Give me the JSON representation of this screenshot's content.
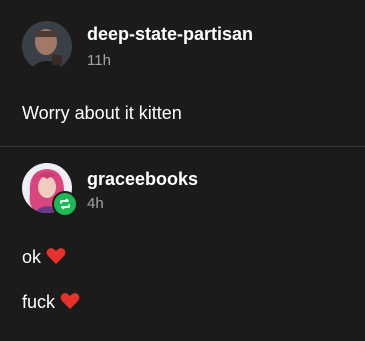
{
  "posts": [
    {
      "author": "deep-state-partisan",
      "time": "11h",
      "body": "Worry about it kitten"
    },
    {
      "author": "graceebooks",
      "time": "4h",
      "lines": [
        "ok",
        "fuck"
      ]
    }
  ],
  "colors": {
    "background": "#1b1b1b",
    "text": "#ffffff",
    "muted": "#a3a3a3",
    "heart": "#e8312a",
    "reblog_badge": "#1db954"
  }
}
